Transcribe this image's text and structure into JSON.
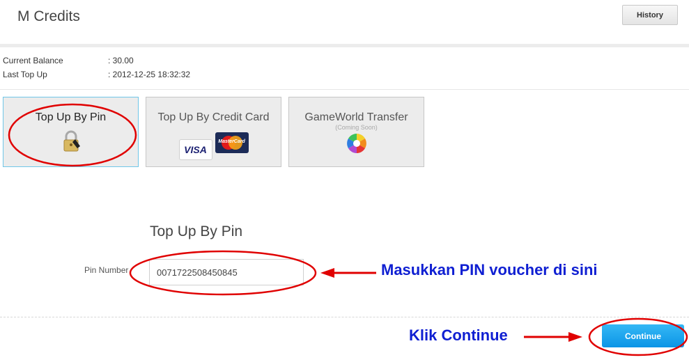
{
  "header": {
    "title": "M Credits",
    "history_label": "History"
  },
  "account": {
    "balance_label": "Current Balance",
    "balance_value": ": 30.00",
    "last_topup_label": "Last Top Up",
    "last_topup_value": ": 2012-12-25 18:32:32"
  },
  "options": [
    {
      "title": "Top Up By Pin",
      "icon": "padlock-icon",
      "selected": true
    },
    {
      "title": "Top Up By Credit Card",
      "icons": [
        "visa-logo",
        "mastercard-logo"
      ],
      "visa_text": "VISA",
      "mc_text": "MasterCard"
    },
    {
      "title": "GameWorld Transfer",
      "subtitle": "(Coming Soon)",
      "icon": "colorful-ball-icon"
    }
  ],
  "form": {
    "title": "Top Up By Pin",
    "pin_label": "Pin Number",
    "pin_value": "0071722508450845",
    "continue_label": "Continue"
  },
  "annotations": {
    "pin_hint": "Masukkan PIN voucher di sini",
    "continue_hint": "Klik Continue",
    "color": "#0f1fd2",
    "highlight_color": "#e00000"
  },
  "colors": {
    "accent_button": "#1aa3ef",
    "card_background": "#ececec",
    "active_card_border": "#6fc6e8"
  }
}
